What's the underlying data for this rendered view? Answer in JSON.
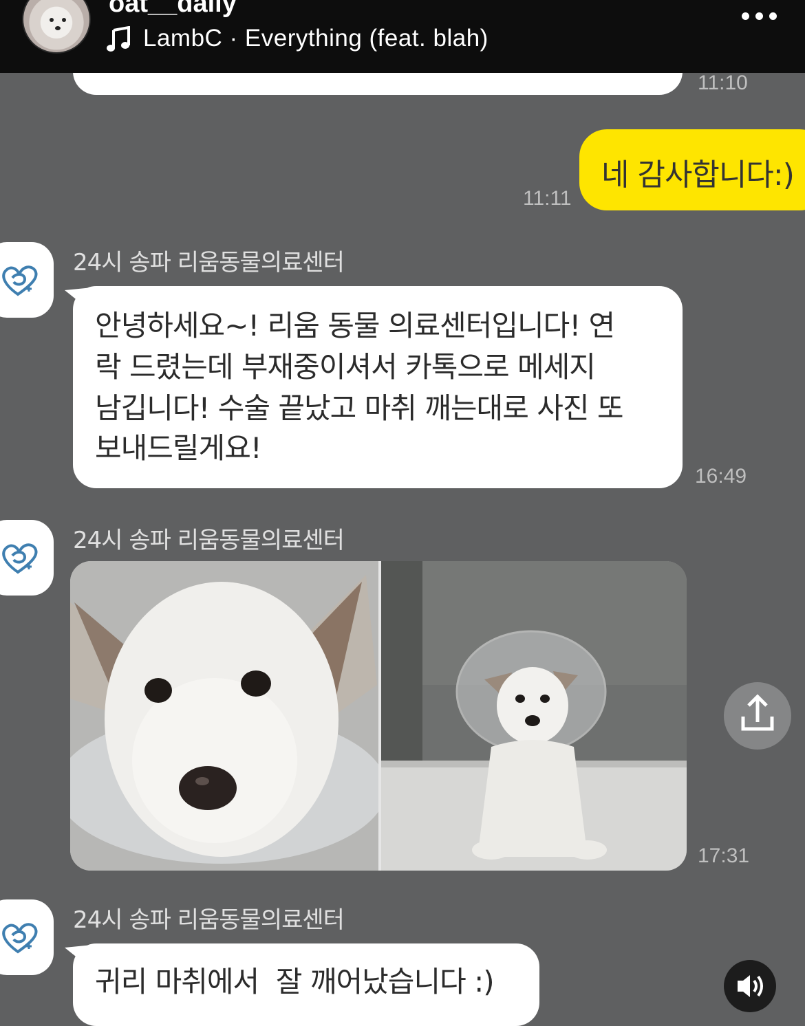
{
  "header": {
    "username": "oat__daily",
    "song": "LambC · Everything (feat. blah)"
  },
  "chat": {
    "top_partial_time": "11:10",
    "my_message": {
      "text": "네 감사합니다:)",
      "time": "11:11"
    },
    "messages": [
      {
        "sender": "24시 송파 리움동물의료센터",
        "lines": [
          "안녕하세요~! 리움 동물 의료센터입니다! 연",
          "락 드렸는데 부재중이셔서 카톡으로 메세지",
          "남깁니다! 수술 끝났고 마취 깨는대로 사진 또",
          "보내드릴게요!"
        ],
        "time": "16:49"
      },
      {
        "sender": "24시 송파 리움동물의료센터",
        "time": "17:31"
      },
      {
        "sender": "24시 송파 리움동물의료센터",
        "text": "귀리 마취에서  잘 깨어났습니다 :)"
      }
    ]
  },
  "colors": {
    "background": "#5f6061",
    "my_bubble": "#fee500",
    "other_bubble": "#ffffff",
    "topbar": "#0d0d0d"
  },
  "icons": [
    "music-note-icon",
    "more-icon",
    "clinic-logo-icon",
    "share-icon",
    "sound-icon"
  ]
}
